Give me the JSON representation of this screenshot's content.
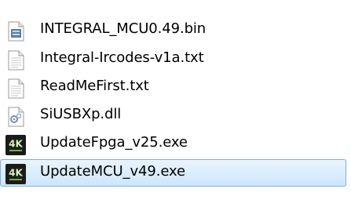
{
  "files": [
    {
      "name": "INTEGRAL_MCU0.49.bin",
      "icon": "bin-file-icon",
      "selected": false
    },
    {
      "name": "Integral-Ircodes-v1a.txt",
      "icon": "text-file-icon",
      "selected": false
    },
    {
      "name": "ReadMeFirst.txt",
      "icon": "text-file-icon",
      "selected": false
    },
    {
      "name": "SiUSBXp.dll",
      "icon": "dll-file-icon",
      "selected": false
    },
    {
      "name": "UpdateFpga_v25.exe",
      "icon": "4k-app-icon",
      "selected": false
    },
    {
      "name": "UpdateMCU_v49.exe",
      "icon": "4k-app-icon",
      "selected": true
    }
  ],
  "icon_badge_text": "4K",
  "colors": {
    "selection_fill": "#cde6fa",
    "selection_border": "#84acdd",
    "app_icon_bg": "#1b1b1b",
    "app_icon_text": "#d9f0c0"
  }
}
